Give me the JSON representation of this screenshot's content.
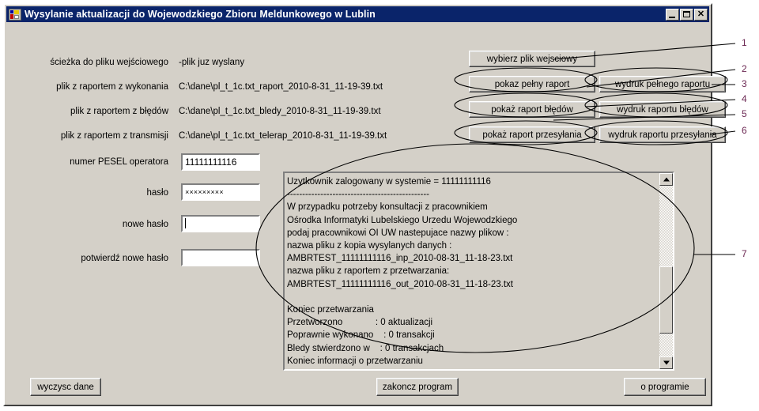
{
  "window": {
    "title": "Wysylanie aktualizacji do Wojewodzkiego Zbioru Meldunkowego w Lublin",
    "icon": "app-icon",
    "minimize_label": "_",
    "maximize_label": "□",
    "close_label": "✕",
    "titlebar_color": "#0a246a",
    "face_color": "#d4d0c8"
  },
  "form": {
    "rows": [
      {
        "label": "ścieżka do pliku wejściowego",
        "value": "-plik juz wyslany"
      },
      {
        "label": "plik z raportem z wykonania",
        "value": "C:\\dane\\pl_t_1c.txt_raport_2010-8-31_11-19-39.txt"
      },
      {
        "label": "plik z raportem z błędów",
        "value": "C:\\dane\\pl_t_1c.txt_bledy_2010-8-31_11-19-39.txt"
      },
      {
        "label": "plik z raportem z transmisji",
        "value": "C:\\dane\\pl_t_1c.txt_telerap_2010-8-31_11-19-39.txt"
      }
    ],
    "pesel": {
      "label": "numer PESEL operatora",
      "value": "11111111116"
    },
    "password": {
      "label": "hasło",
      "value": "×××××××××"
    },
    "new_password": {
      "label": "nowe hasło",
      "value": ""
    },
    "confirm_password": {
      "label": "potwierdź nowe hasło",
      "value": ""
    }
  },
  "buttons": {
    "choose_file": "wybierz plik wejsciowy",
    "show_full_report": "pokaz pełny raport",
    "print_full_report": "wydruk pełnego raportu",
    "show_error_report": "pokaż raport błędów",
    "print_error_report": "wydruk raportu błędów",
    "show_transmission_report": "pokaż raport przesyłania",
    "print_transmission_report": "wydruk raportu przesyłania",
    "clear_data": "wyczysc dane",
    "exit_program": "zakoncz program",
    "about": "o programie"
  },
  "log": {
    "content": "Uzytkownik zalogowany w systemie = 11111111116\n-----------------------------------------------\nW przypadku potrzeby konsultacji z pracownikiem\nOśrodka Informatyki Lubelskiego Urzedu Wojewodzkiego\npodaj pracownikowi OI UW nastepujace nazwy plikow :\nnazwa pliku z kopia wysylanych danych :\nAMBRTEST_11111111116_inp_2010-08-31_11-18-23.txt\nnazwa pliku z raportem z przetwarzania:\nAMBRTEST_11111111116_out_2010-08-31_11-18-23.txt\n\nKoniec przetwarzania\nPrzetworzono             : 0 aktualizacji\nPoprawnie wykonano    : 0 transakcji\nBledy stwierdzono w    : 0 transakcjach\nKoniec informacji o przetwarzaniu",
    "scroll_up_icon": "triangle-up-icon",
    "scroll_down_icon": "triangle-down-icon"
  },
  "annotations": {
    "color": "#6b2752",
    "numbers": [
      "1",
      "2",
      "3",
      "4",
      "5",
      "6",
      "7"
    ]
  }
}
